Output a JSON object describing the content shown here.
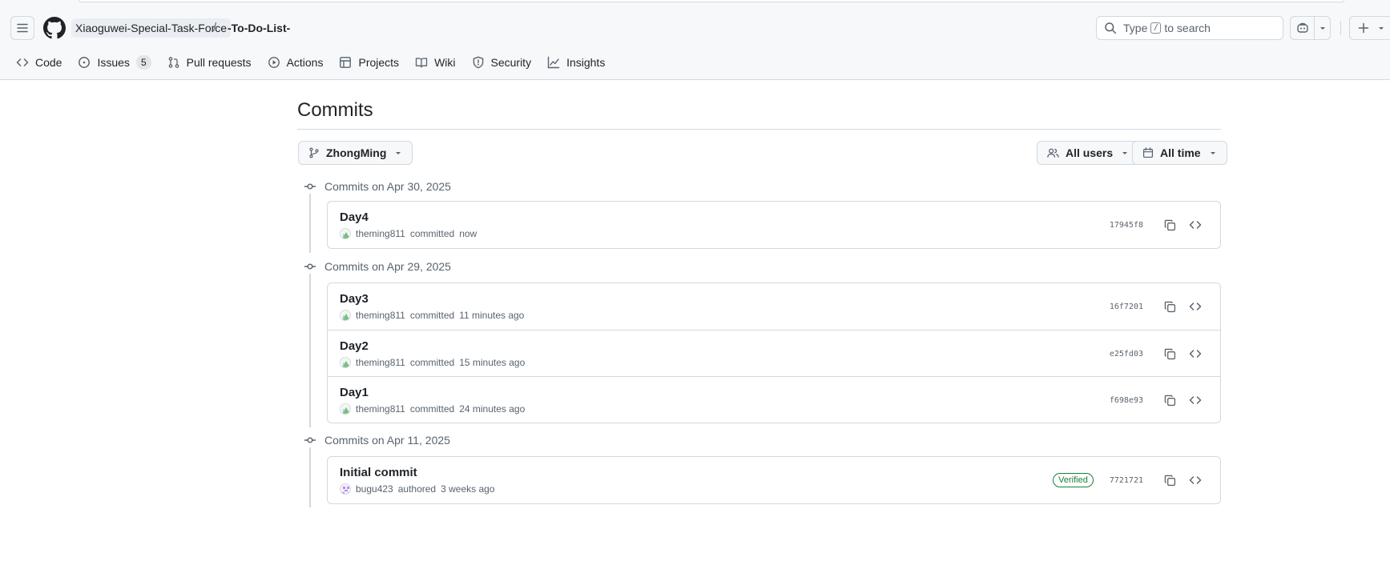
{
  "header": {
    "owner": "Xiaoguwei-Special-Task-Force",
    "separator": "/",
    "repo": "-To-Do-List-",
    "search": {
      "before": "Type",
      "key": "/",
      "after": "to search"
    }
  },
  "tabs": [
    {
      "label": "Code",
      "icon": "code-icon"
    },
    {
      "label": "Issues",
      "icon": "issue-icon",
      "count": "5"
    },
    {
      "label": "Pull requests",
      "icon": "pull-request-icon"
    },
    {
      "label": "Actions",
      "icon": "play-icon"
    },
    {
      "label": "Projects",
      "icon": "table-icon"
    },
    {
      "label": "Wiki",
      "icon": "book-icon"
    },
    {
      "label": "Security",
      "icon": "shield-icon"
    },
    {
      "label": "Insights",
      "icon": "graph-icon"
    }
  ],
  "page": {
    "title": "Commits",
    "branch": "ZhongMing",
    "users_filter": "All users",
    "time_filter": "All time"
  },
  "groups": [
    {
      "heading": "Commits on Apr 30, 2025",
      "commits": [
        {
          "message": "Day4",
          "author": "theming811",
          "action": "committed",
          "time": "now",
          "sha": "17945f8"
        }
      ]
    },
    {
      "heading": "Commits on Apr 29, 2025",
      "commits": [
        {
          "message": "Day3",
          "author": "theming811",
          "action": "committed",
          "time": "11 minutes ago",
          "sha": "16f7201"
        },
        {
          "message": "Day2",
          "author": "theming811",
          "action": "committed",
          "time": "15 minutes ago",
          "sha": "e25fd03"
        },
        {
          "message": "Day1",
          "author": "theming811",
          "action": "committed",
          "time": "24 minutes ago",
          "sha": "f698e93"
        }
      ]
    },
    {
      "heading": "Commits on Apr 11, 2025",
      "commits": [
        {
          "message": "Initial commit",
          "author": "bugu423",
          "action": "authored",
          "time": "3 weeks ago",
          "sha": "7721721",
          "badge": "Verified"
        }
      ]
    }
  ],
  "colors": {
    "accent_green": "#1a7f37",
    "border": "#d1d9e0",
    "muted_text": "#59636e",
    "header_bg": "#f6f8fa"
  }
}
